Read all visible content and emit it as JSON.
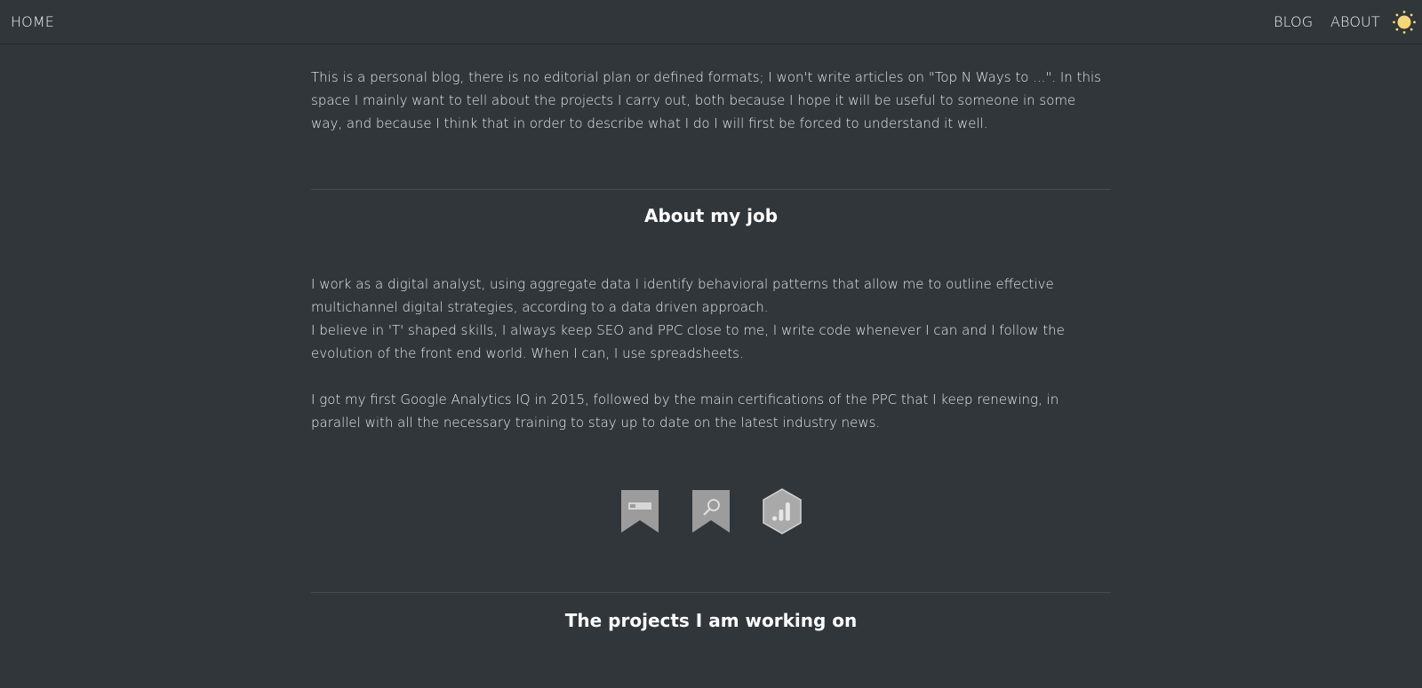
{
  "nav": {
    "home": "HOME",
    "blog": "BLOG",
    "about": "ABOUT",
    "theme_icon": "sun-icon"
  },
  "intro": {
    "text": "This is a personal blog, there is no editorial plan or defined formats; I won't write articles on \"Top N Ways to ...\". In this space I mainly want to tell about the projects I carry out, both because I hope it will be useful to someone in some way, and because I think that in order to describe what I do I will first be forced to understand it well."
  },
  "job": {
    "title": "About my job",
    "paragraph1": "I work as a digital analyst, using aggregate data I identify behavioral patterns that allow me to outline effective multichannel digital strategies, according to a data driven approach.",
    "paragraph2": "I believe in 'T' shaped skills, I always keep SEO and PPC close to me, I write code whenever I can and I follow the evolution of the front end world. When I can, I use spreadsheets.",
    "paragraph3": "I got my first Google Analytics IQ in 2015, followed by the main certifications of the PPC that I keep renewing, in parallel with all the necessary training to stay up to date on the latest industry news."
  },
  "badges": [
    {
      "icon": "ads-certification-icon"
    },
    {
      "icon": "search-certification-icon"
    },
    {
      "icon": "analytics-certification-icon"
    }
  ],
  "projects": {
    "title": "The projects I am working on"
  },
  "colors": {
    "background": "#31363b",
    "text": "#e6e8ea",
    "sun": "#f7d774",
    "badge": "#9a9a9a"
  }
}
